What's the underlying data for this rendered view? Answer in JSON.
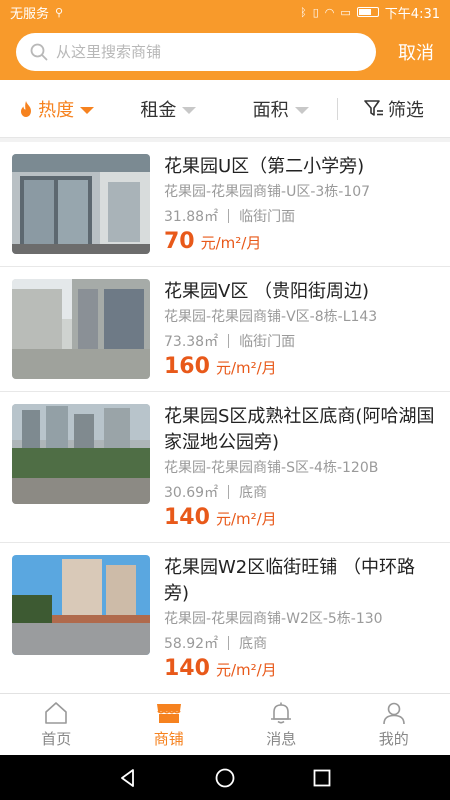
{
  "status_bar": {
    "carrier": "无服务",
    "time": "下午4:31"
  },
  "search": {
    "placeholder": "从这里搜索商铺",
    "cancel_label": "取消"
  },
  "filters": [
    {
      "label": "热度",
      "active": true
    },
    {
      "label": "租金",
      "active": false
    },
    {
      "label": "面积",
      "active": false
    },
    {
      "label": "筛选",
      "active": false
    }
  ],
  "listings": [
    {
      "title": "花果园U区（第二小学旁)",
      "address": "花果园-花果园商铺-U区-3栋-107",
      "area": "31.88㎡",
      "type": "临街门面",
      "price": "70",
      "price_unit": "元/m²/月"
    },
    {
      "title": "花果园V区 （贵阳街周边)",
      "address": "花果园-花果园商铺-V区-8栋-L143",
      "area": "73.38㎡",
      "type": "临街门面",
      "price": "160",
      "price_unit": "元/m²/月"
    },
    {
      "title": "花果园S区成熟社区底商(阿哈湖国家湿地公园旁)",
      "address": "花果园-花果园商铺-S区-4栋-120B",
      "area": "30.69㎡",
      "type": "底商",
      "price": "140",
      "price_unit": "元/m²/月"
    },
    {
      "title": "花果园W2区临街旺铺 （中环路旁)",
      "address": "花果园-花果园商铺-W2区-5栋-130",
      "area": "58.92㎡",
      "type": "底商",
      "price": "140",
      "price_unit": "元/m²/月"
    }
  ],
  "tabs": [
    {
      "label": "首页",
      "icon": "home-icon",
      "active": false
    },
    {
      "label": "商铺",
      "icon": "shop-icon",
      "active": true
    },
    {
      "label": "消息",
      "icon": "bell-icon",
      "active": false
    },
    {
      "label": "我的",
      "icon": "user-icon",
      "active": false
    }
  ],
  "colors": {
    "accent": "#f89a2b",
    "price": "#e8591a",
    "active_tab": "#f6821f"
  }
}
